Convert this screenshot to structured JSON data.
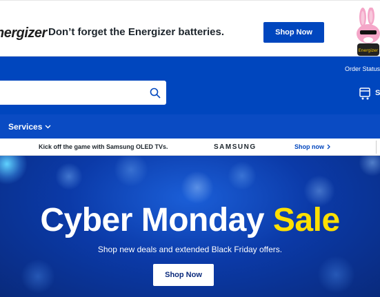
{
  "ad": {
    "logo_text": "nergizer",
    "headline": "Don’t forget the Energizer batteries.",
    "cta": "Shop Now",
    "brand_color": "#0046be"
  },
  "header": {
    "order_status": "Order Status",
    "search": {
      "value": "",
      "placeholder": ""
    },
    "cart_label": "S",
    "bg_color": "#0046be"
  },
  "nav": {
    "services_label": "Services"
  },
  "promo": {
    "text": "Kick off the game with Samsung OLED TVs.",
    "brand": "SAMSUNG",
    "link": "Shop now"
  },
  "hero": {
    "title_main": "Cyber Monday",
    "title_highlight": "Sale",
    "subtitle": "Shop new deals and extended Black Friday offers.",
    "cta": "Shop Now",
    "highlight_color": "#ffe000"
  }
}
